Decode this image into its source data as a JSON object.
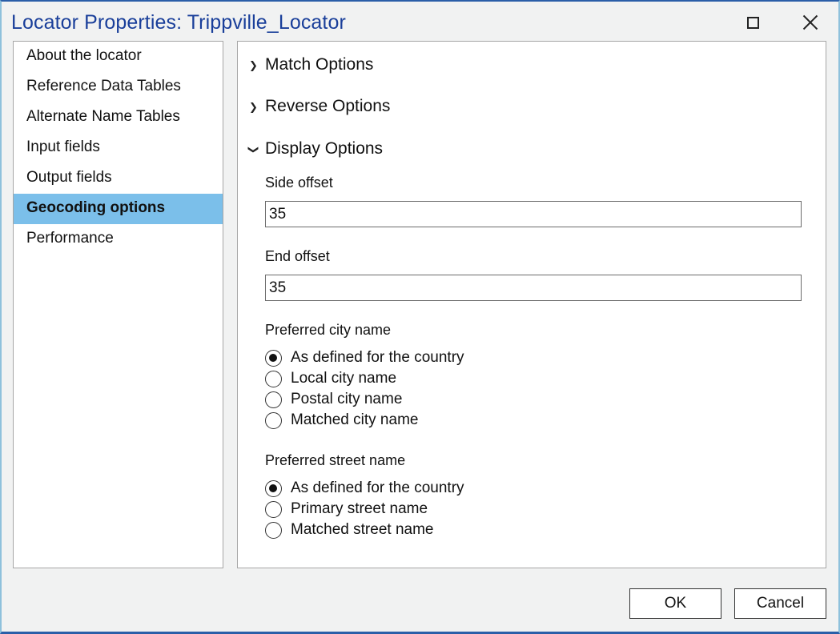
{
  "window": {
    "title": "Locator Properties: Trippville_Locator",
    "maximize_icon": "maximize-icon",
    "close_icon": "close-icon"
  },
  "nav": {
    "items": [
      {
        "label": "About the locator",
        "selected": false
      },
      {
        "label": "Reference Data Tables",
        "selected": false
      },
      {
        "label": "Alternate Name Tables",
        "selected": false
      },
      {
        "label": "Input fields",
        "selected": false
      },
      {
        "label": "Output fields",
        "selected": false
      },
      {
        "label": "Geocoding options",
        "selected": true
      },
      {
        "label": "Performance",
        "selected": false
      }
    ],
    "selected_color": "#7bbfea"
  },
  "sections": {
    "match": {
      "label": "Match Options",
      "expanded": false
    },
    "reverse": {
      "label": "Reverse Options",
      "expanded": false
    },
    "display": {
      "label": "Display Options",
      "expanded": true
    }
  },
  "display_options": {
    "side_offset": {
      "label": "Side offset",
      "value": "35"
    },
    "end_offset": {
      "label": "End offset",
      "value": "35"
    },
    "preferred_city": {
      "label": "Preferred city name",
      "options": [
        {
          "label": "As defined for the country",
          "checked": true
        },
        {
          "label": "Local city name",
          "checked": false
        },
        {
          "label": "Postal city name",
          "checked": false
        },
        {
          "label": "Matched city name",
          "checked": false
        }
      ]
    },
    "preferred_street": {
      "label": "Preferred street name",
      "options": [
        {
          "label": "As defined for the country",
          "checked": true
        },
        {
          "label": "Primary street name",
          "checked": false
        },
        {
          "label": "Matched street name",
          "checked": false
        }
      ]
    }
  },
  "buttons": {
    "ok": "OK",
    "cancel": "Cancel"
  }
}
